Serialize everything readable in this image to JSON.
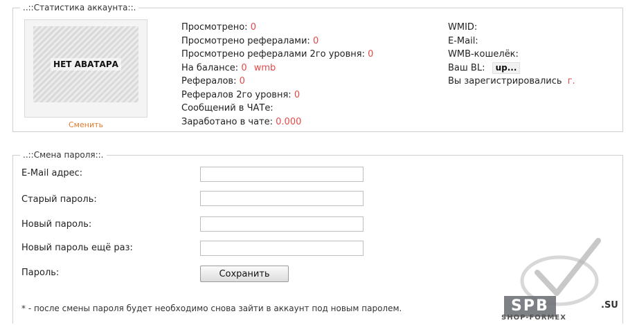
{
  "stats_section": {
    "legend": "..::Статистика аккаунта::.",
    "avatar_text": "НЕТ АВАТАРА",
    "avatar_change": "Сменить",
    "viewed_label": "Просмотрено:",
    "viewed_value": "0",
    "viewed_by_refs_label": "Просмотрено рефералами:",
    "viewed_by_refs_value": "0",
    "viewed_by_refs_l2_label": "Просмотрено рефералами 2го уровня:",
    "viewed_by_refs_l2_value": "0",
    "balance_label": "На балансе:",
    "balance_value": "0",
    "balance_unit": "wmb",
    "refs_label": "Рефералов:",
    "refs_value": "0",
    "refs_l2_label": "Рефералов 2го уровня:",
    "refs_l2_value": "0",
    "chat_msgs_label": "Сообщений в ЧАТе:",
    "chat_earned_label": "Заработано в чате:",
    "chat_earned_value": "0.000",
    "wmid_label": "WMID:",
    "email_label": "E-Mail:",
    "wmb_wallet_label": "WMB-кошелёк:",
    "bl_label": "Ваш BL:",
    "bl_value": "up...",
    "registered_label": "Вы зарегистрировались",
    "registered_value": "г."
  },
  "password_section": {
    "legend": "..::Смена пароля::.",
    "email_label": "E-Mail адрес:",
    "old_password_label": "Старый пароль:",
    "new_password_label": "Новый пароль:",
    "new_password_again_label": "Новый пароль ещё раз:",
    "password_label": "Пароль:",
    "save_button": "Сохранить",
    "note": "* - после смены пароля будет необходимо снова зайти в аккаунт под новым паролем."
  },
  "watermark": {
    "badge": "SPB",
    "sub": "SHOP-FORMEX",
    "su": ".SU"
  },
  "colors": {
    "value_red": "#e34848",
    "link_orange": "#e07a2e",
    "border": "#cfcfcf"
  }
}
